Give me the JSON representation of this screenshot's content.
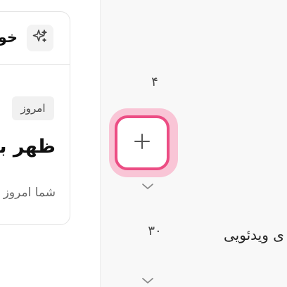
{
  "card": {
    "header_text": "خو",
    "today_label": "امروز",
    "title": "ظهر بخ",
    "subtitle": "شما امروز"
  },
  "counters": {
    "first": "۴",
    "second": "۳۰"
  },
  "right_item": {
    "label": "ی ویدئویی"
  },
  "colors": {
    "accent": "#ec4d84",
    "accent_glow": "#f9c5d6",
    "panel_bg": "#f8f8f8"
  },
  "icons": {
    "ai": "sparkles-icon",
    "add": "plus-icon",
    "expand": "chevron-down-icon"
  }
}
